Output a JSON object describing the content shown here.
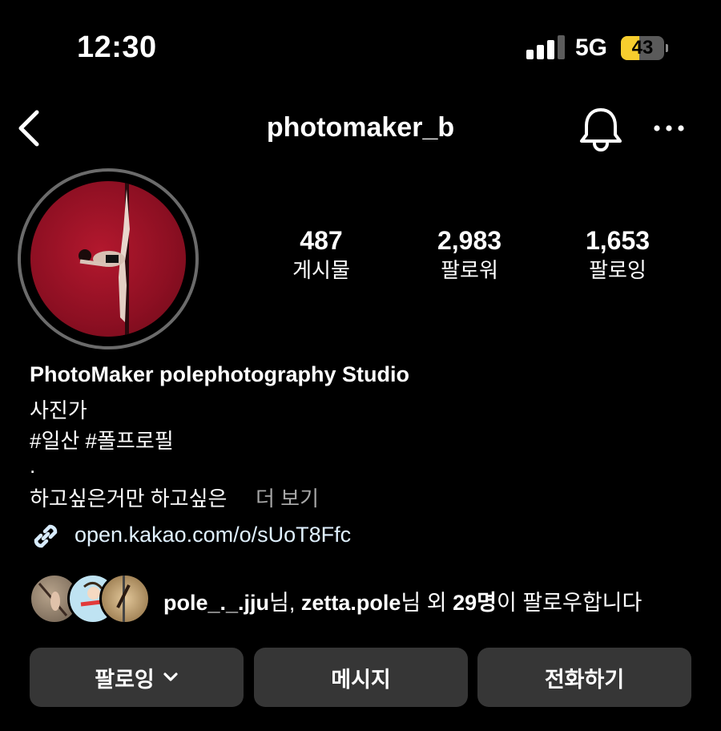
{
  "status_bar": {
    "time": "12:30",
    "network": "5G",
    "battery": "43",
    "battery_level": 0.43
  },
  "nav": {
    "username": "photomaker_b",
    "icons": [
      "back-chevron-icon",
      "bell-icon",
      "more-horizontal-icon"
    ]
  },
  "stats": [
    {
      "number": "487",
      "label": "게시물"
    },
    {
      "number": "2,983",
      "label": "팔로워"
    },
    {
      "number": "1,653",
      "label": "팔로잉"
    }
  ],
  "bio": {
    "name": "PhotoMaker polephotography Studio",
    "category": "사진가",
    "hashtags": "#일산 #폴프로필",
    "dot": ".",
    "truncated": "하고싶은거만 하고싶은",
    "more": "더 보기",
    "link": "open.kakao.com/o/sUoT8Ffc"
  },
  "followed_by": {
    "user1": "pole_._.jju",
    "sep1": "님, ",
    "user2": "zetta.pole",
    "sep2": "님 외 ",
    "count": "29명",
    "suffix": "이 팔로우합니다"
  },
  "buttons": {
    "following": "팔로잉",
    "message": "메시지",
    "call": "전화하기"
  },
  "colors": {
    "background": "#000000",
    "button_bg": "#363636",
    "battery_yellow": "#f7ce2e",
    "link_text": "#e0f1ff",
    "muted_text": "#a8a8a8"
  }
}
